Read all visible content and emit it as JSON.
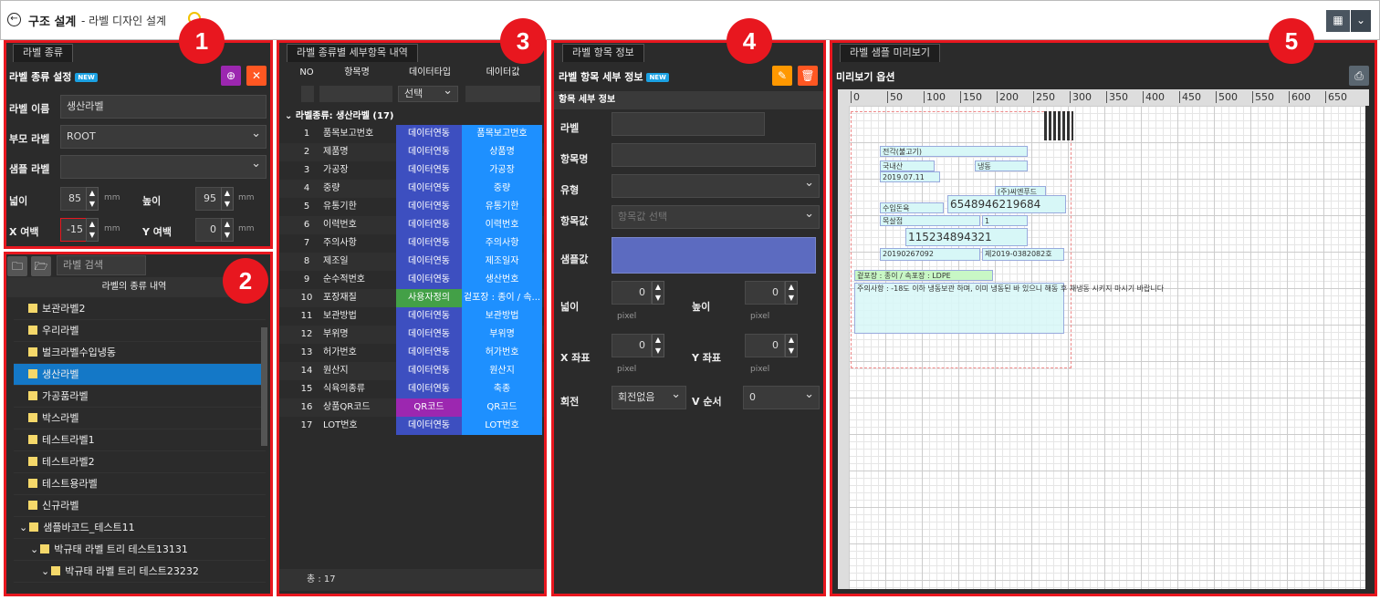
{
  "header": {
    "title": "구조 설계",
    "subtitle": "- 라벨 디자인 설계",
    "back_icon": "back-arrow-icon"
  },
  "p1": {
    "tab": "라벨 종류",
    "heading": "라벨 종류 설정",
    "new_badge": "NEW",
    "fields": {
      "name_label": "라벨 이름",
      "name_value": "생산라벨",
      "parent_label": "부모 라벨",
      "parent_value": "ROOT",
      "sample_label": "샘플 라벨",
      "sample_value": "",
      "width_label": "넓이",
      "width_value": "85",
      "width_unit": "mm",
      "height_label": "높이",
      "height_value": "95",
      "height_unit": "mm",
      "xm_label": "X 여백",
      "xm_value": "-15",
      "xm_unit": "mm",
      "ym_label": "Y 여백",
      "ym_value": "0",
      "ym_unit": "mm"
    }
  },
  "p2": {
    "search_placeholder": "라벨 검색",
    "list_header": "라벨의 종류 내역",
    "items": [
      "보관라벨2",
      "우리라벨",
      "벌크라벨수입냉동",
      "생산라벨",
      "가공품라벨",
      "박스라벨",
      "테스트라벨1",
      "테스트라벨2",
      "테스트용라벨",
      "신규라벨",
      "샘플바코드_테스트11",
      "박규태 라벨 트리 테스트13131",
      "박규태 라벨 트리 테스트23232"
    ]
  },
  "p3": {
    "tab": "라벨 종류별 세부항목 내역",
    "cols": [
      "NO",
      "항목명",
      "데이터타입",
      "데이터값"
    ],
    "filter_select": "선택",
    "group": "라벨종류: 생산라벨 (17)",
    "rows": [
      [
        "1",
        "품목보고번호",
        "데이터연동",
        "품목보고번호"
      ],
      [
        "2",
        "제품명",
        "데이터연동",
        "상품명"
      ],
      [
        "3",
        "가공장",
        "데이터연동",
        "가공장"
      ],
      [
        "4",
        "중량",
        "데이터연동",
        "중량"
      ],
      [
        "5",
        "유통기한",
        "데이터연동",
        "유통기한"
      ],
      [
        "6",
        "이력번호",
        "데이터연동",
        "이력번호"
      ],
      [
        "7",
        "주의사항",
        "데이터연동",
        "주의사항"
      ],
      [
        "8",
        "제조일",
        "데이터연동",
        "제조일자"
      ],
      [
        "9",
        "순수적번호",
        "데이터연동",
        "생산번호"
      ],
      [
        "10",
        "포장재질",
        "사용자정의",
        "겉포장 : 종이 / 속..."
      ],
      [
        "11",
        "보관방법",
        "데이터연동",
        "보관방법"
      ],
      [
        "12",
        "부위명",
        "데이터연동",
        "부위명"
      ],
      [
        "13",
        "허가번호",
        "데이터연동",
        "허가번호"
      ],
      [
        "14",
        "원산지",
        "데이터연동",
        "원산지"
      ],
      [
        "15",
        "식육의종류",
        "데이터연동",
        "축종"
      ],
      [
        "16",
        "상품QR코드",
        "QR코드",
        "QR코드"
      ],
      [
        "17",
        "LOT번호",
        "데이터연동",
        "LOT번호"
      ]
    ],
    "footer": "총 : 17",
    "colors": {
      "blue": "#3d4fc0",
      "light": "#1e90ff",
      "green": "#43a047",
      "purple": "#9c27b0"
    }
  },
  "p4": {
    "tab": "라벨 항목 정보",
    "heading": "라벨 항목 세부 정보",
    "new_badge": "NEW",
    "section": "항목 세부 정보",
    "label_l": "라벨",
    "name_l": "항목명",
    "type_l": "유형",
    "value_l": "항목값",
    "value_ph": "항목값 선택",
    "sample_l": "샘플값",
    "w_l": "넓이",
    "w_v": "0",
    "h_l": "높이",
    "h_v": "0",
    "unit": "pixel",
    "x_l": "X 좌표",
    "x_v": "0",
    "y_l": "Y 좌표",
    "y_v": "0",
    "rot_l": "회전",
    "rot_v": "회전없음",
    "ord_l": "V 순서",
    "ord_v": "0"
  },
  "p5": {
    "tab": "라벨 샘플 미리보기",
    "heading": "미리보기 옵션",
    "ruler": [
      "0",
      "50",
      "100",
      "150",
      "200",
      "250",
      "300",
      "350",
      "400",
      "450",
      "500",
      "550",
      "600",
      "650"
    ],
    "cells": {
      "c1": "전각(불고기)",
      "c2": "국내산",
      "c3": "냉동",
      "c4": "2019.07.11",
      "c5": "(주)씨엔푸드",
      "c6": "6548946219684",
      "c7": "수입돈육",
      "c8": "목살접",
      "c9": "1",
      "c10": "115234894321",
      "c11": "20190267092",
      "c12": "제2019-0382082호",
      "c13": "겉포장 : 종이 / 속포장 : LDPE",
      "c14": "주의사항 : -18도 이하 냉동보관 하며, 이미 냉동된 바 있으니 해동 후 재냉동 시키지 마시기 바랍니다"
    }
  },
  "badges": [
    "1",
    "2",
    "3",
    "4",
    "5"
  ]
}
